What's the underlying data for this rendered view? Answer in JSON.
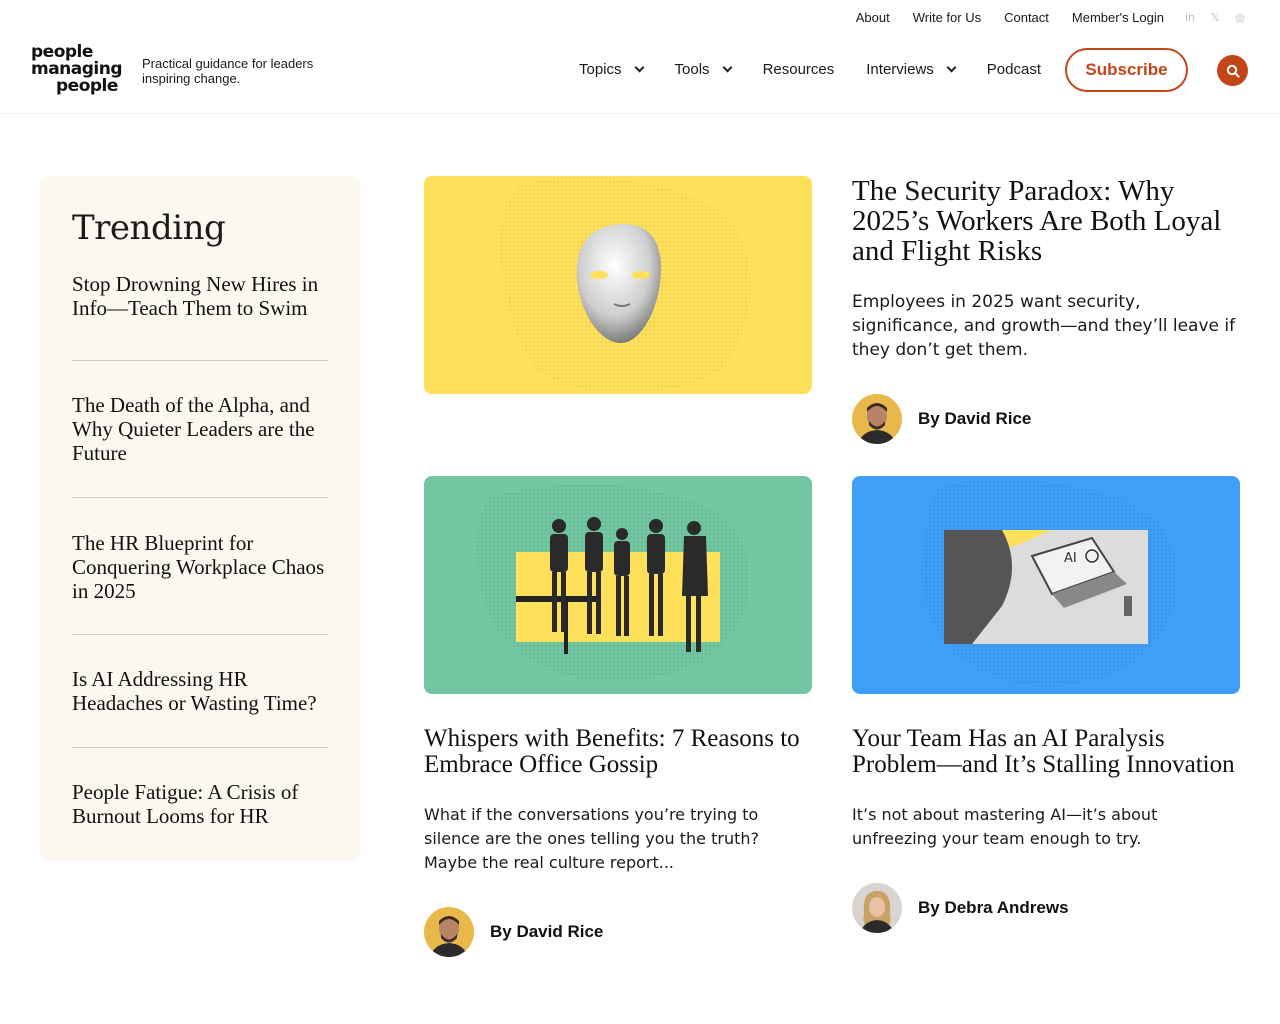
{
  "utility_nav": {
    "links": [
      "About",
      "Write for Us",
      "Contact",
      "Member's Login"
    ],
    "social_icons": [
      "linkedin-icon",
      "x-icon",
      "instagram-icon"
    ],
    "social_glyphs": [
      "in",
      "𝕏",
      "◎"
    ]
  },
  "brand": {
    "logo_lines": [
      "people",
      "managing",
      "people"
    ],
    "tagline": "Practical guidance for leaders inspiring change."
  },
  "main_nav": {
    "items": [
      {
        "label": "Topics",
        "dropdown": true
      },
      {
        "label": "Tools",
        "dropdown": true
      },
      {
        "label": "Resources",
        "dropdown": false
      },
      {
        "label": "Interviews",
        "dropdown": true
      },
      {
        "label": "Podcast",
        "dropdown": false
      }
    ],
    "subscribe_label": "Subscribe",
    "search_icon": "search-icon"
  },
  "colors": {
    "accent": "#c2461a",
    "trending_bg": "#fcf7ef",
    "yellow": "#ffe05a",
    "green": "#72c6a1",
    "blue": "#3e9ef8"
  },
  "trending": {
    "heading": "Trending",
    "items": [
      "Stop Drowning New Hires in Info—Teach Them to Swim",
      "The Death of the Alpha, and Why Quieter Leaders are the Future",
      "The HR Blueprint for Conquering Workplace Chaos in 2025",
      "Is AI Addressing HR Headaches or Wasting Time?",
      "People Fatigue: A Crisis of Burnout Looms for HR"
    ]
  },
  "featured": {
    "title": "The Security Paradox: Why 2025’s Workers Are Both Loyal and Flight Risks",
    "excerpt": "Employees in 2025 want security, significance, and growth—and they’ll leave if they don’t get them.",
    "author": "By David Rice"
  },
  "cards": [
    {
      "title": "Whispers with Benefits: 7 Reasons to Embrace Office Gossip",
      "excerpt": "What if the conversations you’re trying to silence are the ones telling you the truth? Maybe the real culture report...",
      "author": "By David Rice"
    },
    {
      "title": "Your Team Has an AI Paralysis Problem—and It’s Stalling Innovation",
      "excerpt": "It’s not about mastering AI—it’s about unfreezing your team enough to try.",
      "author": "By Debra Andrews",
      "image_label": "AI"
    }
  ]
}
